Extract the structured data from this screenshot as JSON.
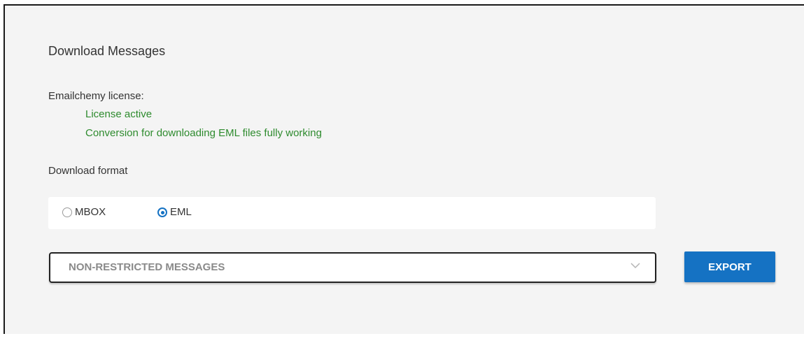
{
  "panel": {
    "title": "Download Messages",
    "license": {
      "label": "Emailchemy license:",
      "status_lines": [
        "License active",
        "Conversion for downloading EML files fully working"
      ],
      "status_color": "#2e8b2e"
    },
    "format": {
      "label": "Download format",
      "options": [
        {
          "label": "MBOX",
          "selected": false
        },
        {
          "label": "EML",
          "selected": true
        }
      ]
    },
    "message_filter": {
      "selected": "NON-RESTRICTED MESSAGES",
      "icon": "chevron-down-icon"
    },
    "export_button": {
      "label": "EXPORT",
      "color": "#1572c3"
    }
  }
}
